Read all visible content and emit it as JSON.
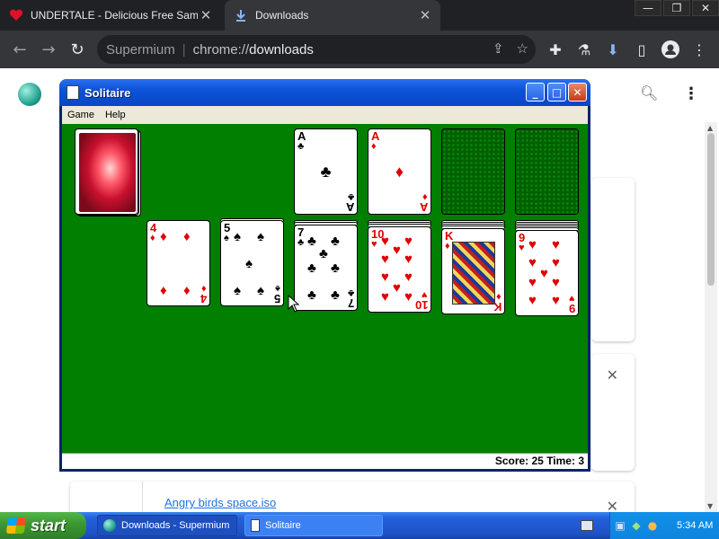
{
  "browser": {
    "tabs": [
      {
        "title": "UNDERTALE - Delicious Free Sample",
        "icon": "heart-icon",
        "active": false
      },
      {
        "title": "Downloads",
        "icon": "download-icon",
        "active": true
      }
    ],
    "address": {
      "site": "Supermium",
      "separator": "|",
      "scheme": "chrome://",
      "host": "downloads"
    }
  },
  "downloads_page": {
    "item_link": "Angry birds space.iso"
  },
  "solitaire": {
    "title": "Solitaire",
    "menu": [
      "Game",
      "Help"
    ],
    "status": "Score: 25 Time: 3",
    "foundations": [
      {
        "rank": "A",
        "suit": "♣",
        "color": "black"
      },
      {
        "rank": "A",
        "suit": "♦",
        "color": "red"
      }
    ],
    "tableau": [
      {
        "rank": "4",
        "suit": "♦",
        "color": "red"
      },
      {
        "rank": "5",
        "suit": "♠",
        "color": "black"
      },
      {
        "rank": "7",
        "suit": "♣",
        "color": "black"
      },
      {
        "rank": "10",
        "suit": "♥",
        "color": "red"
      },
      {
        "rank": "K",
        "suit": "♦",
        "color": "red"
      },
      {
        "rank": "9",
        "suit": "♥",
        "color": "red"
      }
    ]
  },
  "taskbar": {
    "start": "start",
    "tasks": [
      "Downloads - Supermium",
      "Solitaire"
    ],
    "clock": "5:34 AM"
  }
}
